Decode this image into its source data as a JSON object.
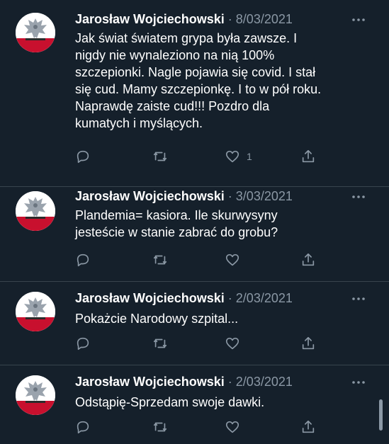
{
  "tweets": [
    {
      "author": "Jarosław Wojciechowski",
      "separator": "·",
      "date": "8/03/2021",
      "text": "Jak świat światem grypa była zawsze. I\nnigdy nie wynaleziono na nią 100%\nszczepionki. Nagle pojawia się covid. I stał\nsię cud. Mamy szczepionkę. I to w pół roku.\nNaprawdę zaiste cud!!! Pozdro dla\nkumatych i myślących.",
      "likes": "1"
    },
    {
      "author": "Jarosław Wojciechowski",
      "separator": "·",
      "date": "3/03/2021",
      "text": "Plandemia= kasiora. Ile skurwysyny\njesteście w stanie zabrać do grobu?",
      "likes": ""
    },
    {
      "author": "Jarosław Wojciechowski",
      "separator": "·",
      "date": "2/03/2021",
      "text": "Pokażcie Narodowy szpital...",
      "likes": ""
    },
    {
      "author": "Jarosław Wojciechowski",
      "separator": "·",
      "date": "2/03/2021",
      "text": "Odstąpię-Sprzedam swoje dawki.",
      "likes": ""
    }
  ],
  "colors": {
    "background": "#15202b",
    "text": "#ffffff",
    "secondary": "#8b98a5",
    "divider": "#38444d",
    "avatar_red": "#c8102e"
  },
  "icons": [
    "avatar-eagle-emblem",
    "more-icon",
    "reply-icon",
    "retweet-icon",
    "like-icon",
    "share-icon"
  ]
}
